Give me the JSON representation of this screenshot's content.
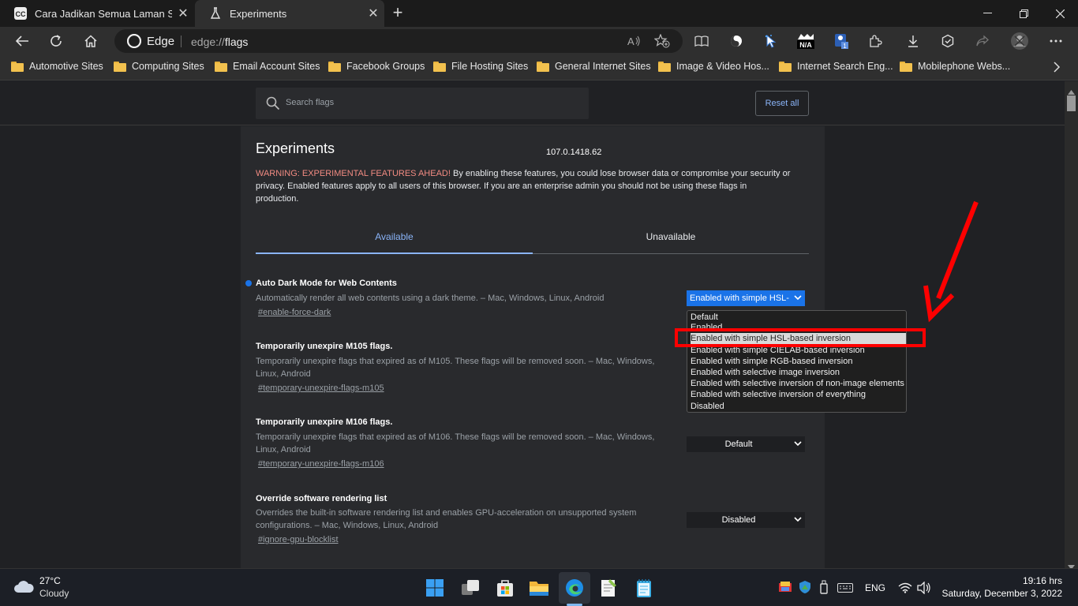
{
  "tabs": [
    {
      "title": "Cara Jadikan Semua Laman Sesuai",
      "active": false
    },
    {
      "title": "Experiments",
      "active": true
    }
  ],
  "address": {
    "browser_label": "Edge",
    "url_scheme": "edge://",
    "url_path": "flags"
  },
  "bookmarks": [
    "Automotive Sites",
    "Computing Sites",
    "Email Account Sites",
    "Facebook Groups",
    "File Hosting Sites",
    "General Internet Sites",
    "Image & Video Hos...",
    "Internet Search Eng...",
    "Mobilephone Webs..."
  ],
  "flags_page": {
    "search_placeholder": "Search flags",
    "reset_label": "Reset all",
    "title": "Experiments",
    "version": "107.0.1418.62",
    "warning_prefix": "WARNING: EXPERIMENTAL FEATURES AHEAD!",
    "warning_line1": " By enabling these features, you could lose browser data or compromise your security or",
    "warning_line2": "privacy. Enabled features apply to all users of this browser. If you are an enterprise admin you should not be using these flags in",
    "warning_line3": "production.",
    "tab_available": "Available",
    "tab_unavailable": "Unavailable",
    "flags": [
      {
        "title": "Auto Dark Mode for Web Contents",
        "desc1": "Automatically render all web contents using a dark theme. – Mac, Windows, Linux, Android",
        "desc2": "",
        "link": "#enable-force-dark",
        "value": "Enabled with simple HSL-"
      },
      {
        "title": "Temporarily unexpire M105 flags.",
        "desc1": "Temporarily unexpire flags that expired as of M105. These flags will be removed soon. – Mac, Windows,",
        "desc2": "Linux, Android",
        "link": "#temporary-unexpire-flags-m105",
        "value": ""
      },
      {
        "title": "Temporarily unexpire M106 flags.",
        "desc1": "Temporarily unexpire flags that expired as of M106. These flags will be removed soon. – Mac, Windows,",
        "desc2": "Linux, Android",
        "link": "#temporary-unexpire-flags-m106",
        "value": "Default"
      },
      {
        "title": "Override software rendering list",
        "desc1": "Overrides the built-in software rendering list and enables GPU-acceleration on unsupported system",
        "desc2": "configurations. – Mac, Windows, Linux, Android",
        "link": "#ignore-gpu-blocklist",
        "value": "Disabled"
      }
    ],
    "dropdown_options": [
      "Default",
      "Enabled",
      "Enabled with simple HSL-based inversion",
      "Enabled with simple CIELAB-based inversion",
      "Enabled with simple RGB-based inversion",
      "Enabled with selective image inversion",
      "Enabled with selective inversion of non-image elements",
      "Enabled with selective inversion of everything",
      "Disabled"
    ],
    "highlighted_option": "Enabled with simple HSL-based inversion"
  },
  "colors": {
    "accent": "#8ab4f8",
    "select_active": "#1a73e8",
    "annotation": "#ff0000",
    "warning": "#f28b82"
  },
  "taskbar": {
    "weather_temp": "27°C",
    "weather_desc": "Cloudy",
    "lang": "ENG",
    "time": "19:16 hrs",
    "date": "Saturday, December 3, 2022"
  }
}
